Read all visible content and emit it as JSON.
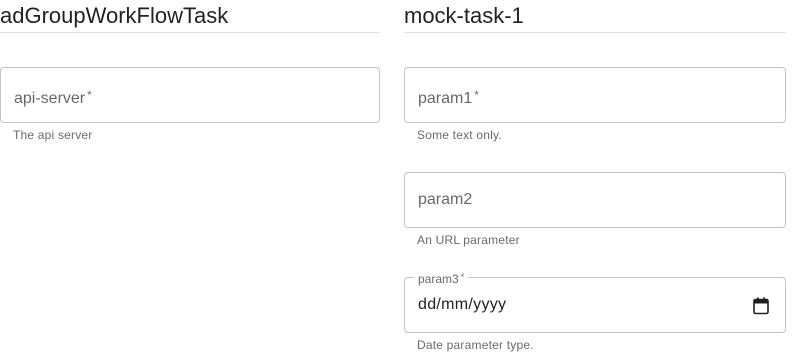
{
  "left_section": {
    "title": "adGroupWorkFlowTask",
    "fields": [
      {
        "label": "api-server",
        "required_mark": "*",
        "helper": "The api server"
      }
    ]
  },
  "right_section": {
    "title": "mock-task-1",
    "fields": [
      {
        "label": "param1",
        "required_mark": "*",
        "helper": "Some text only."
      },
      {
        "label": "param2",
        "helper": "An URL parameter"
      },
      {
        "label": "param3",
        "required_mark": "*",
        "placeholder": "dd/mm/yyyy",
        "icon": "calendar-icon",
        "helper": "Date parameter type."
      }
    ]
  },
  "colors": {
    "border": "#c4c4c4",
    "divider": "#e0e0e0",
    "text_secondary": "#757575"
  }
}
